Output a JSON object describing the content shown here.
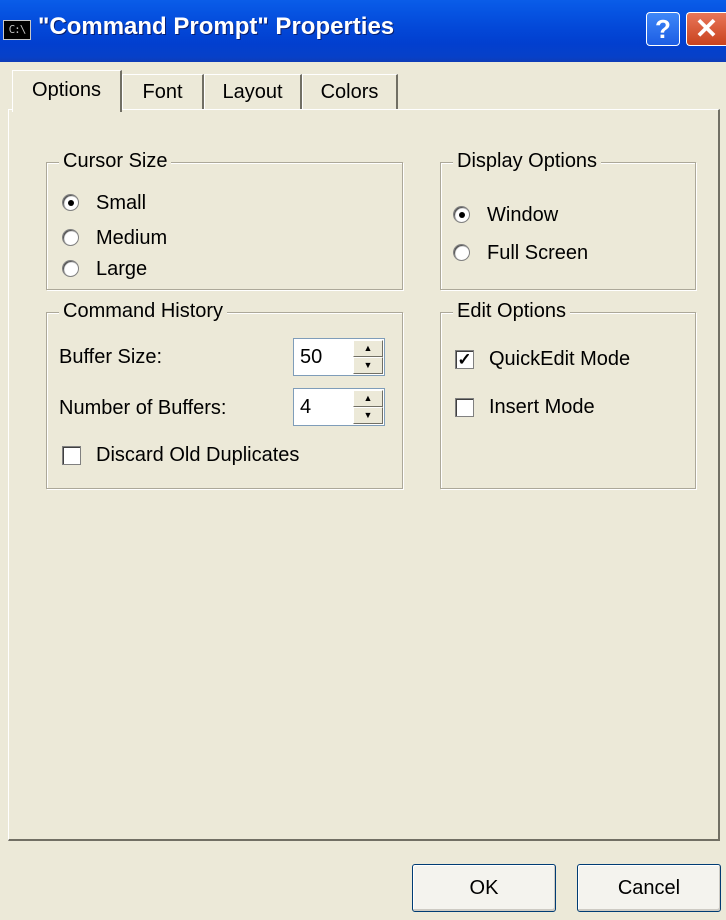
{
  "window": {
    "title": "\"Command Prompt\" Properties",
    "app_icon_text": "C:\\",
    "help_label": "?",
    "close_label": "✕"
  },
  "tabs": [
    {
      "label": "Options"
    },
    {
      "label": "Font"
    },
    {
      "label": "Layout"
    },
    {
      "label": "Colors"
    }
  ],
  "cursor_size": {
    "legend": "Cursor Size",
    "options": [
      {
        "label": "Small",
        "selected": true
      },
      {
        "label": "Medium",
        "selected": false
      },
      {
        "label": "Large",
        "selected": false
      }
    ]
  },
  "display_options": {
    "legend": "Display Options",
    "options": [
      {
        "label": "Window",
        "selected": true
      },
      {
        "label": "Full Screen",
        "selected": false
      }
    ]
  },
  "command_history": {
    "legend": "Command History",
    "buffer_size_label": "Buffer Size:",
    "buffer_size_value": "50",
    "num_buffers_label": "Number of Buffers:",
    "num_buffers_value": "4",
    "discard_label": "Discard Old Duplicates",
    "discard_checked": false
  },
  "edit_options": {
    "legend": "Edit Options",
    "quickedit_label": "QuickEdit Mode",
    "quickedit_checked": true,
    "insert_label": "Insert Mode",
    "insert_checked": false
  },
  "buttons": {
    "ok": "OK",
    "cancel": "Cancel"
  },
  "colors": {
    "titlebar": "#0348D8",
    "dialog_bg": "#ECE9D8",
    "close_button": "#D9542E"
  }
}
